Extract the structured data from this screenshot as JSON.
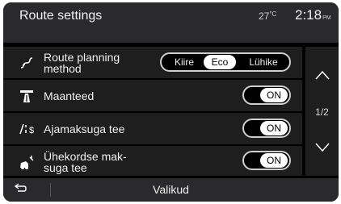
{
  "header": {
    "title": "Route settings",
    "temperature": "27",
    "temperature_unit": "°C",
    "time": "2:18",
    "ampm": "PM"
  },
  "rows": [
    {
      "label": "Route planning\nmethod",
      "icon": "route-icon",
      "control": "segmented",
      "options": [
        "Kiire",
        "Eco",
        "Lühike"
      ],
      "selected": "Eco"
    },
    {
      "label": "Maanteed",
      "icon": "highway-icon",
      "control": "toggle",
      "value": "ON"
    },
    {
      "label": "Ajamaksuga tee",
      "icon": "toll-road-icon",
      "control": "toggle",
      "value": "ON"
    },
    {
      "label": "Ühekordse mak-\nsuga tee",
      "icon": "toll-booth-icon",
      "control": "toggle",
      "value": "ON"
    }
  ],
  "pager": {
    "page": "1/2",
    "up_icon": "chevron-up-icon",
    "down_icon": "chevron-down-icon"
  },
  "footer": {
    "title": "Valikud",
    "back_icon": "back-arrow-icon"
  }
}
